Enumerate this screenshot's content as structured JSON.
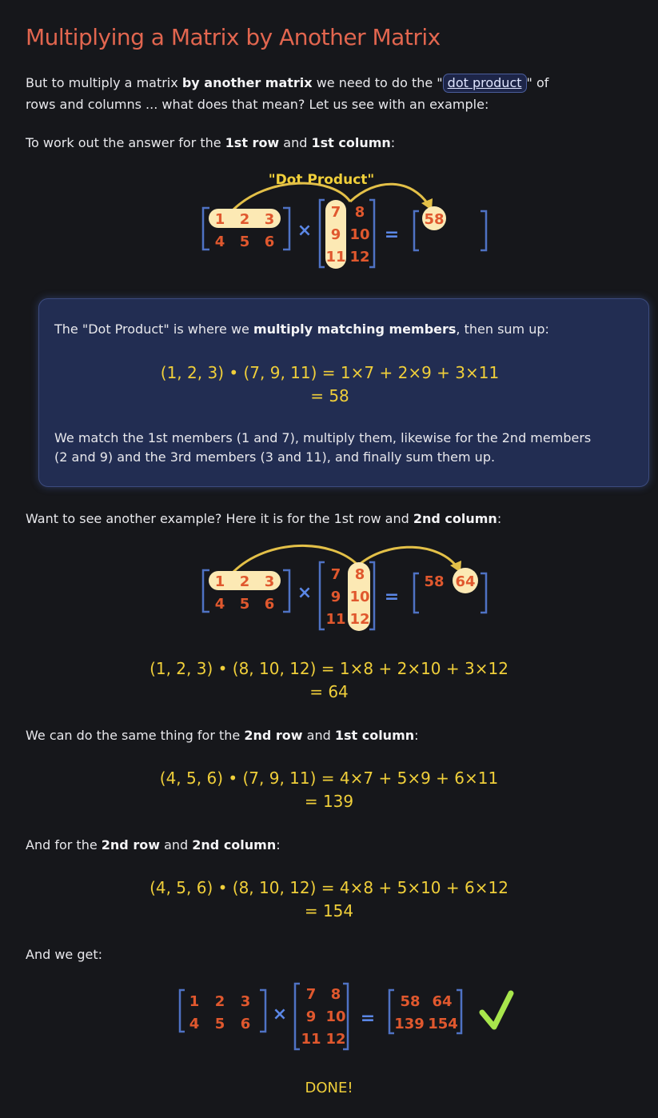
{
  "heading": "Multiplying a Matrix by Another Matrix",
  "intro": {
    "part1": "But to multiply a matrix ",
    "bold1": "by another matrix",
    "part2": " we need to do the \"",
    "link": "dot product",
    "part3": "\" of",
    "line2": "rows and columns ... what does that mean? Let us see with an example:"
  },
  "step1": {
    "part1": "To work out the answer for the ",
    "bold1": "1st row",
    "part2": " and ",
    "bold2": "1st column",
    "part3": ":"
  },
  "diagram1": {
    "caption": "\"Dot Product\"",
    "matrix_a": [
      [
        "1",
        "2",
        "3"
      ],
      [
        "4",
        "5",
        "6"
      ]
    ],
    "times": "×",
    "matrix_b": [
      [
        "7",
        "8"
      ],
      [
        "9",
        "10"
      ],
      [
        "11",
        "12"
      ]
    ],
    "equals": "=",
    "result": "58"
  },
  "infobox": {
    "part1": "The \"Dot Product\" is where we ",
    "bold1": "multiply matching members",
    "part2": ", then sum up:",
    "eq_line1": "(1, 2, 3) • (7, 9, 11) = 1×7 + 2×9 + 3×11",
    "eq_line2": "= 58",
    "para_line1": "We match the 1st members (1 and 7), multiply them, likewise for the 2nd members",
    "para_line2": "(2 and 9) and the 3rd members (3 and 11), and finally sum them up."
  },
  "step2": {
    "part1": "Want to see another example? Here it is for the 1st row and ",
    "bold1": "2nd column",
    "part2": ":"
  },
  "diagram2": {
    "result1": "58",
    "result2": "64"
  },
  "eq2": {
    "line1": "(1, 2, 3) • (8, 10, 12) = 1×8 + 2×10 + 3×12",
    "line2": "= 64"
  },
  "step3": {
    "part1": "We can do the same thing for the ",
    "bold1": "2nd row",
    "part2": " and ",
    "bold2": "1st column",
    "part3": ":"
  },
  "eq3": {
    "line1": "(4, 5, 6) • (7, 9, 11) = 4×7 + 5×9 + 6×11",
    "line2": "= 139"
  },
  "step4": {
    "part1": "And for the ",
    "bold1": "2nd row",
    "part2": " and ",
    "bold2": "2nd column",
    "part3": ":"
  },
  "eq4": {
    "line1": "(4, 5, 6) • (8, 10, 12) = 4×8 + 5×10 + 6×12",
    "line2": "= 154"
  },
  "step5": "And we get:",
  "final": {
    "result": [
      [
        "58",
        "64"
      ],
      [
        "139",
        "154"
      ]
    ],
    "check_icon": "checkmark-icon"
  },
  "done": "DONE!",
  "colors": {
    "background": "#16171b",
    "heading": "#e2664f",
    "number": "#e0582e",
    "bracket": "#4f72c4",
    "highlight": "#fce9b4",
    "equation": "#f0cf3a",
    "check": "#a8e64c",
    "box": "#222d52"
  }
}
